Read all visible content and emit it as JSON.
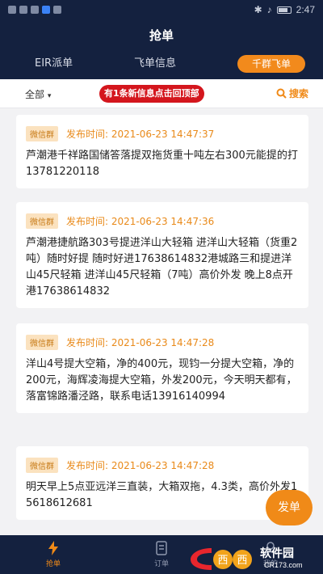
{
  "statusbar": {
    "time": "2:47"
  },
  "header": {
    "title": "抢单"
  },
  "tabs": [
    {
      "label": "EIR派单"
    },
    {
      "label": "飞单信息"
    },
    {
      "label": "千群飞单"
    }
  ],
  "filter": {
    "all_label": "全部",
    "notice": "有1条新信息点击回顶部",
    "search_label": "搜索"
  },
  "feed": [
    {
      "tag": "微信群",
      "time": "发布时间: 2021-06-23 14:47:37",
      "content": "芦潮港千祥路国储答落提双拖货重十吨左右300元能提的打13781220118"
    },
    {
      "tag": "微信群",
      "time": "发布时间: 2021-06-23 14:47:36",
      "content": "芦潮港捷航路303号提进洋山大轻箱 进洋山大轻箱（货重2吨）随时好提 随时好进17638614832港城路三和提进洋山45尺轻箱 进洋山45尺轻箱（7吨）高价外发 晚上8点开港17638614832"
    },
    {
      "tag": "微信群",
      "time": "发布时间: 2021-06-23 14:47:28",
      "content": "洋山4号提大空箱，净的400元，现钧一分提大空箱，净的200元，海辉凌海提大空箱，外发200元，今天明天都有，落富锦路潘泾路，联系电话13916140994"
    },
    {
      "tag": "微信群",
      "time": "发布时间: 2021-06-23 14:47:28",
      "content": "明天早上5点亚远洋三直装，大箱双拖，4.3类，高价外发15618612681"
    }
  ],
  "fab": {
    "label": "发单"
  },
  "bottomnav": [
    {
      "label": "抢单"
    },
    {
      "label": "订单"
    },
    {
      "label": "我的"
    }
  ],
  "watermark": {
    "text": "软件园",
    "sub": "CR173.com"
  },
  "colors": {
    "navy": "#14213f",
    "accent": "#f08a18",
    "alert": "#d4161d"
  }
}
